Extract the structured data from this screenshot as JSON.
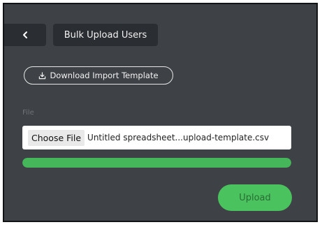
{
  "header": {
    "back_icon": "chevron-left-icon",
    "title": "Bulk Upload Users"
  },
  "template_button": {
    "icon": "download-icon",
    "label": "Download Import Template"
  },
  "file_section": {
    "label": "File",
    "choose_button_label": "Choose File",
    "file_name": "Untitled spreadsheet...upload-template.csv"
  },
  "progress": {
    "fraction": 1.0,
    "color": "#45b75a"
  },
  "upload_button": {
    "label": "Upload",
    "color": "#4ac35e"
  }
}
